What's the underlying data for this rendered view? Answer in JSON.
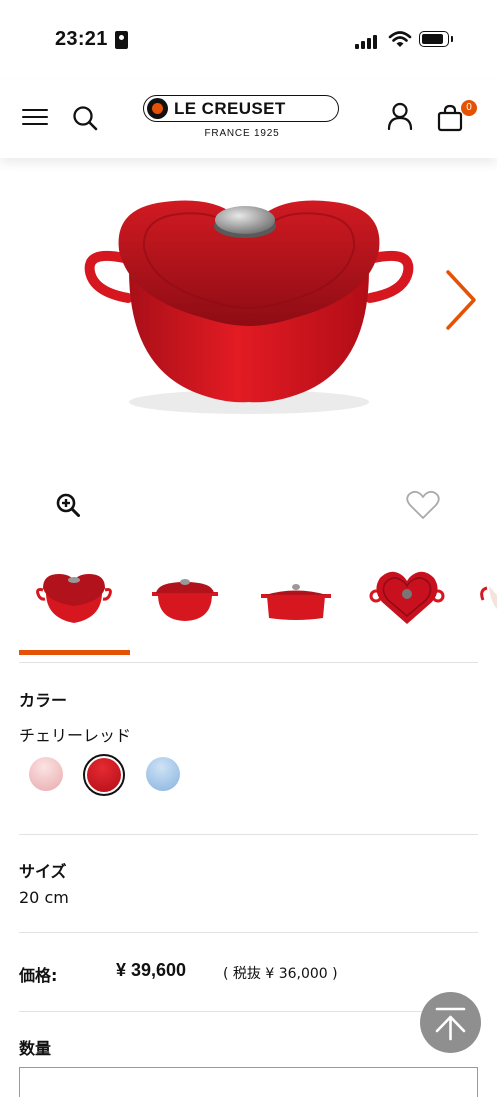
{
  "status_bar": {
    "time": "23:21"
  },
  "header": {
    "brand_name": "LE CREUSET",
    "brand_tagline": "FRANCE 1925",
    "cart_count": "0",
    "icons": [
      "menu-icon",
      "search-icon",
      "account-icon",
      "cart-icon"
    ]
  },
  "gallery": {
    "thumbnail_count": 5,
    "active_thumbnail": 1,
    "icons": [
      "zoom-in-icon",
      "heart-icon",
      "chevron-right-icon"
    ]
  },
  "color": {
    "label": "カラー",
    "selected": "チェリーレッド",
    "swatches": [
      "#efbdbd",
      "#c8101e",
      "#9ec3e6"
    ]
  },
  "size": {
    "label": "サイズ",
    "value": "20 cm"
  },
  "price": {
    "label": "価格:",
    "value": "¥ 39,600",
    "tax_note": "( 税抜 ¥ 36,000 )"
  },
  "quantity": {
    "label": "数量"
  },
  "colors": {
    "accent": "#e35205",
    "pot_red": "#c8101e"
  }
}
